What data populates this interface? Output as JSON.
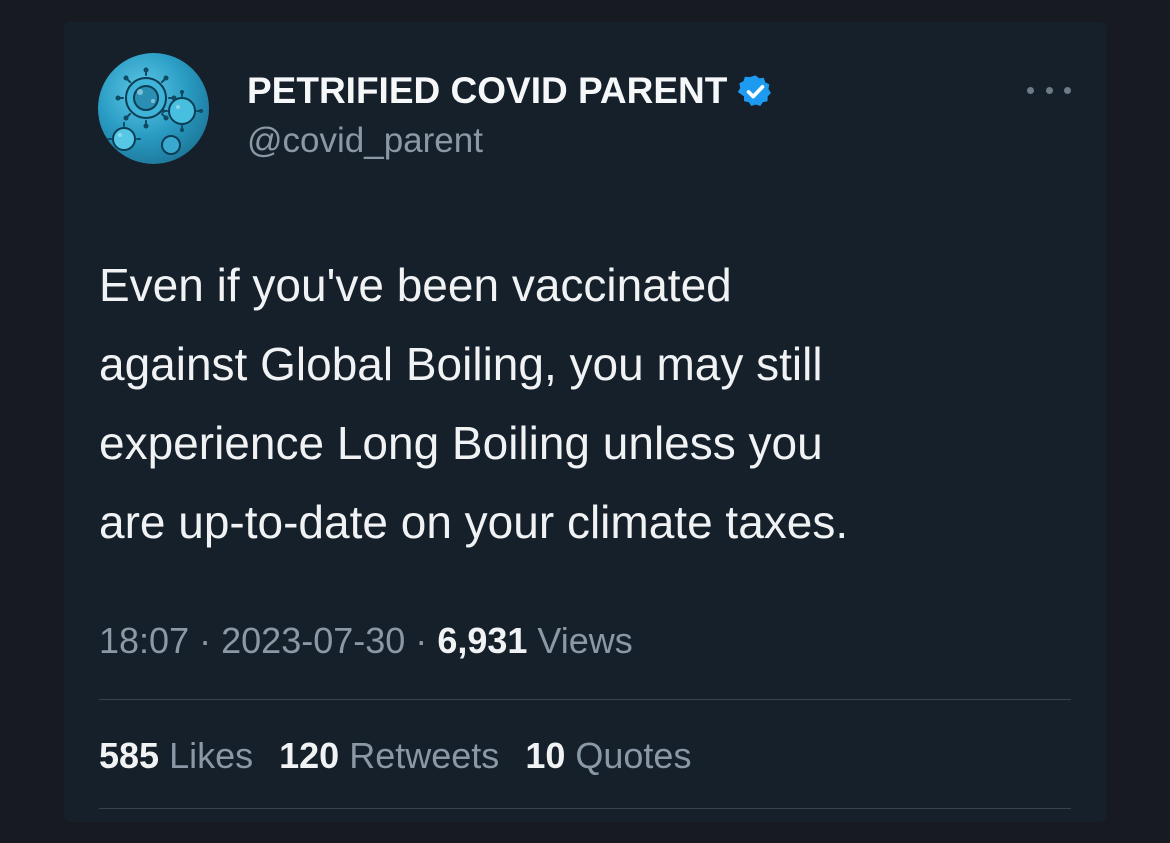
{
  "author": {
    "display_name": "PETRIFIED COVID PARENT",
    "handle": "@covid_parent",
    "verified": true,
    "avatar_icon": "virus-illustration-icon",
    "accent_color": "#1d9bf0"
  },
  "tweet": {
    "text": "Even if you've been vaccinated\nagainst Global Boiling, you may still\nexperience Long Boiling unless you\nare up-to-date on your climate taxes."
  },
  "meta": {
    "time": "18:07",
    "separator": "·",
    "date": "2023-07-30",
    "views_count": "6,931",
    "views_label": "Views"
  },
  "stats": {
    "likes_count": "585",
    "likes_label": "Likes",
    "retweets_count": "120",
    "retweets_label": "Retweets",
    "quotes_count": "10",
    "quotes_label": "Quotes"
  },
  "more_icon": "more-options-icon"
}
